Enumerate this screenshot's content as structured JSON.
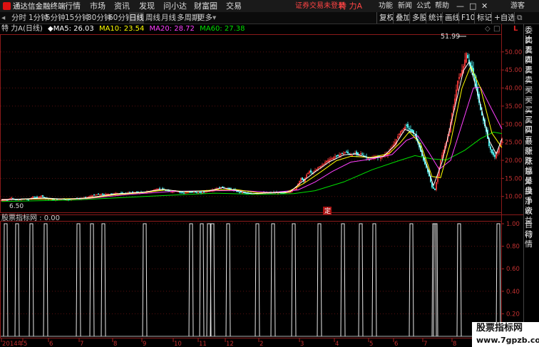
{
  "menubar": {
    "app_title": "通达信金融终端",
    "menus": [
      "行情",
      "市场",
      "资讯",
      "发现",
      "问小达",
      "财富圈",
      "交易"
    ],
    "notice": "证券交易未登录",
    "stock_name": "特 力A",
    "right_items": [
      "功能",
      "新闻",
      "公式",
      "帮助"
    ],
    "user": "游客"
  },
  "toolbar": {
    "periods": [
      "分时",
      "1分钟",
      "5分钟",
      "15分钟",
      "30分钟",
      "60分钟",
      "日线",
      "周线",
      "月线",
      "多周期",
      "更多"
    ],
    "active_period": "日线",
    "tools": [
      "复权",
      "叠加",
      "多股",
      "统计",
      "画线",
      "F10",
      "标记",
      "+自选"
    ]
  },
  "info": {
    "stock": "特 力A",
    "period": "(日线)",
    "ma5_label": "MA5:",
    "ma5": "26.03",
    "ma10_label": "MA10:",
    "ma10": "23.54",
    "ma20_label": "MA20:",
    "ma20": "28.72",
    "ma60_label": "MA60:",
    "ma60": "27.38",
    "colors": {
      "ma5": "#ffffff",
      "ma10": "#ffff00",
      "ma20": "#ff40ff",
      "ma60": "#00e000"
    }
  },
  "price_panel": {
    "high_label": "51.99",
    "low_label": "6.50",
    "marker": "定",
    "yticks": [
      "50.00",
      "45.00",
      "40.00",
      "35.00",
      "30.00",
      "25.00",
      "20.00",
      "15.00",
      "10.00"
    ],
    "ytick_values": [
      50,
      45,
      40,
      35,
      30,
      25,
      20,
      15,
      10
    ],
    "ymin": 6.0,
    "ymax": 54.5
  },
  "indicator_panel": {
    "title": "股票指标网 : 0.00",
    "yticks": [
      "1.00",
      "0.80",
      "0.60",
      "0.40",
      "0.20"
    ]
  },
  "xaxis": {
    "labels": [
      "2014年",
      "5",
      "6",
      "7",
      "8",
      "9",
      "10",
      "11",
      "12",
      "2",
      "3",
      "4",
      "5",
      "6",
      "7",
      "8"
    ]
  },
  "right_panel": {
    "items": [
      "委比",
      "卖五",
      "卖四",
      "卖三",
      "卖二",
      "卖一",
      "买一",
      "买二",
      "买三",
      "买四",
      "买五",
      "最新",
      "涨跌",
      "涨幅",
      "总量",
      "外盘",
      "换手",
      "净资",
      "收益",
      "自动",
      "行情"
    ]
  },
  "chart_data": {
    "type": "candlestick",
    "ylim": [
      6.0,
      54.5
    ],
    "series_names": [
      "MA5",
      "MA10",
      "MA20",
      "MA60"
    ],
    "close_path": [
      [
        0,
        8.9
      ],
      [
        8,
        9.0
      ],
      [
        14,
        9.6
      ],
      [
        20,
        9.0
      ],
      [
        26,
        9.1
      ],
      [
        32,
        9.3
      ],
      [
        38,
        9.1
      ],
      [
        44,
        9.9
      ],
      [
        50,
        9.6
      ],
      [
        56,
        10.2
      ],
      [
        62,
        9.5
      ],
      [
        68,
        9.2
      ],
      [
        74,
        9.0
      ],
      [
        80,
        9.2
      ],
      [
        86,
        9.4
      ],
      [
        92,
        9.0
      ],
      [
        98,
        9.2
      ],
      [
        104,
        9.4
      ],
      [
        110,
        9.3
      ],
      [
        118,
        9.7
      ],
      [
        124,
        10.0
      ],
      [
        130,
        10.4
      ],
      [
        136,
        10.6
      ],
      [
        142,
        10.5
      ],
      [
        148,
        10.7
      ],
      [
        154,
        10.6
      ],
      [
        160,
        10.9
      ],
      [
        166,
        10.8
      ],
      [
        172,
        10.8
      ],
      [
        178,
        11.0
      ],
      [
        184,
        11.1
      ],
      [
        190,
        11.2
      ],
      [
        196,
        11.0
      ],
      [
        202,
        11.2
      ],
      [
        208,
        11.4
      ],
      [
        214,
        11.8
      ],
      [
        220,
        12.1
      ],
      [
        226,
        11.9
      ],
      [
        232,
        11.6
      ],
      [
        238,
        11.3
      ],
      [
        244,
        11.6
      ],
      [
        250,
        11.2
      ],
      [
        256,
        11.0
      ],
      [
        262,
        11.1
      ],
      [
        268,
        11.2
      ],
      [
        274,
        11.1
      ],
      [
        280,
        11.0
      ],
      [
        286,
        11.4
      ],
      [
        292,
        11.6
      ],
      [
        298,
        11.9
      ],
      [
        304,
        12.3
      ],
      [
        310,
        12.6
      ],
      [
        316,
        12.2
      ],
      [
        322,
        12.0
      ],
      [
        328,
        11.6
      ],
      [
        334,
        11.2
      ],
      [
        340,
        11.0
      ],
      [
        346,
        10.8
      ],
      [
        352,
        10.7
      ],
      [
        358,
        10.8
      ],
      [
        364,
        10.9
      ],
      [
        370,
        11.0
      ],
      [
        376,
        11.0
      ],
      [
        382,
        11.1
      ],
      [
        388,
        11.0
      ],
      [
        394,
        10.9
      ],
      [
        400,
        11.2
      ],
      [
        406,
        11.5
      ],
      [
        412,
        12.0
      ],
      [
        416,
        13.5
      ],
      [
        420,
        15.0
      ],
      [
        424,
        14.2
      ],
      [
        428,
        16.0
      ],
      [
        432,
        17.0
      ],
      [
        436,
        16.4
      ],
      [
        440,
        17.2
      ],
      [
        444,
        18.0
      ],
      [
        448,
        18.4
      ],
      [
        452,
        19.0
      ],
      [
        456,
        19.8
      ],
      [
        460,
        20.2
      ],
      [
        464,
        20.6
      ],
      [
        468,
        21.0
      ],
      [
        472,
        21.2
      ],
      [
        476,
        21.8
      ],
      [
        480,
        22.0
      ],
      [
        484,
        22.3
      ],
      [
        488,
        21.7
      ],
      [
        492,
        21.4
      ],
      [
        496,
        22.0
      ],
      [
        500,
        21.6
      ],
      [
        504,
        21.9
      ],
      [
        508,
        21.3
      ],
      [
        512,
        20.8
      ],
      [
        516,
        20.2
      ],
      [
        520,
        20.5
      ],
      [
        524,
        21.0
      ],
      [
        528,
        20.8
      ],
      [
        532,
        20.7
      ],
      [
        536,
        21.3
      ],
      [
        540,
        21.8
      ],
      [
        544,
        22.5
      ],
      [
        548,
        23.6
      ],
      [
        552,
        25.0
      ],
      [
        556,
        26.6
      ],
      [
        560,
        28.0
      ],
      [
        564,
        28.9
      ],
      [
        568,
        29.6
      ],
      [
        572,
        28.6
      ],
      [
        576,
        27.8
      ],
      [
        580,
        27.0
      ],
      [
        584,
        25.0
      ],
      [
        588,
        22.4
      ],
      [
        592,
        20.0
      ],
      [
        596,
        18.0
      ],
      [
        600,
        15.6
      ],
      [
        604,
        12.6
      ],
      [
        608,
        11.8
      ],
      [
        612,
        16.0
      ],
      [
        616,
        20.0
      ],
      [
        620,
        22.8
      ],
      [
        624,
        25.0
      ],
      [
        628,
        28.0
      ],
      [
        632,
        33.0
      ],
      [
        636,
        37.0
      ],
      [
        640,
        42.0
      ],
      [
        644,
        44.0
      ],
      [
        648,
        46.0
      ],
      [
        652,
        49.6
      ],
      [
        656,
        47.0
      ],
      [
        660,
        45.0
      ],
      [
        664,
        42.0
      ],
      [
        668,
        38.0
      ],
      [
        672,
        34.0
      ],
      [
        676,
        31.0
      ],
      [
        680,
        28.0
      ],
      [
        684,
        24.0
      ],
      [
        688,
        22.0
      ],
      [
        692,
        21.0
      ],
      [
        696,
        22.4
      ],
      [
        700,
        24.6
      ],
      [
        702,
        26.0
      ]
    ],
    "ma5": [
      [
        0,
        9.0
      ],
      [
        30,
        9.3
      ],
      [
        60,
        9.6
      ],
      [
        90,
        9.2
      ],
      [
        120,
        9.6
      ],
      [
        160,
        10.7
      ],
      [
        200,
        11.2
      ],
      [
        226,
        12.0
      ],
      [
        250,
        11.4
      ],
      [
        290,
        11.5
      ],
      [
        310,
        12.4
      ],
      [
        330,
        11.7
      ],
      [
        350,
        10.8
      ],
      [
        380,
        11.0
      ],
      [
        405,
        11.3
      ],
      [
        420,
        13.8
      ],
      [
        440,
        16.8
      ],
      [
        460,
        19.6
      ],
      [
        480,
        21.5
      ],
      [
        496,
        21.8
      ],
      [
        516,
        20.6
      ],
      [
        536,
        21.1
      ],
      [
        552,
        24.2
      ],
      [
        566,
        28.6
      ],
      [
        580,
        27.4
      ],
      [
        596,
        19.0
      ],
      [
        606,
        13.0
      ],
      [
        618,
        19.5
      ],
      [
        634,
        33.0
      ],
      [
        648,
        44.8
      ],
      [
        656,
        47.2
      ],
      [
        670,
        37.0
      ],
      [
        684,
        25.5
      ],
      [
        694,
        21.8
      ],
      [
        702,
        26.0
      ]
    ],
    "ma10": [
      [
        0,
        9.1
      ],
      [
        40,
        9.3
      ],
      [
        80,
        9.3
      ],
      [
        120,
        9.5
      ],
      [
        160,
        10.5
      ],
      [
        200,
        11.1
      ],
      [
        230,
        11.8
      ],
      [
        260,
        11.3
      ],
      [
        300,
        11.8
      ],
      [
        330,
        11.9
      ],
      [
        360,
        11.0
      ],
      [
        400,
        11.1
      ],
      [
        424,
        13.6
      ],
      [
        448,
        16.8
      ],
      [
        470,
        19.9
      ],
      [
        490,
        21.1
      ],
      [
        520,
        20.8
      ],
      [
        544,
        21.9
      ],
      [
        560,
        25.0
      ],
      [
        572,
        27.9
      ],
      [
        588,
        24.5
      ],
      [
        604,
        15.5
      ],
      [
        616,
        15.2
      ],
      [
        630,
        25.0
      ],
      [
        646,
        40.0
      ],
      [
        658,
        46.0
      ],
      [
        672,
        40.0
      ],
      [
        688,
        27.5
      ],
      [
        702,
        23.5
      ]
    ],
    "ma20": [
      [
        0,
        9.2
      ],
      [
        60,
        9.3
      ],
      [
        120,
        9.4
      ],
      [
        180,
        10.6
      ],
      [
        240,
        11.4
      ],
      [
        300,
        11.6
      ],
      [
        340,
        11.6
      ],
      [
        380,
        11.1
      ],
      [
        416,
        11.8
      ],
      [
        440,
        14.0
      ],
      [
        464,
        16.9
      ],
      [
        490,
        19.5
      ],
      [
        520,
        20.4
      ],
      [
        548,
        21.6
      ],
      [
        568,
        25.5
      ],
      [
        584,
        26.8
      ],
      [
        600,
        22.0
      ],
      [
        614,
        17.5
      ],
      [
        630,
        20.0
      ],
      [
        646,
        30.0
      ],
      [
        662,
        40.0
      ],
      [
        672,
        40.2
      ],
      [
        688,
        34.0
      ],
      [
        702,
        28.7
      ]
    ],
    "ma60": [
      [
        0,
        8.6
      ],
      [
        100,
        9.0
      ],
      [
        200,
        10.0
      ],
      [
        300,
        10.9
      ],
      [
        360,
        10.6
      ],
      [
        410,
        10.8
      ],
      [
        440,
        11.6
      ],
      [
        480,
        14.0
      ],
      [
        520,
        17.4
      ],
      [
        556,
        19.8
      ],
      [
        580,
        21.3
      ],
      [
        604,
        20.4
      ],
      [
        624,
        20.1
      ],
      [
        650,
        22.8
      ],
      [
        672,
        26.0
      ],
      [
        690,
        27.8
      ],
      [
        702,
        27.4
      ]
    ],
    "indicator_spikes_x": [
      6,
      22,
      42,
      62,
      108,
      127,
      143,
      201,
      266,
      281,
      291,
      296,
      318,
      359,
      381,
      410,
      446,
      479,
      504,
      523,
      575,
      607,
      609,
      642,
      697
    ],
    "indicator_value": 0.0,
    "indicator_ylim": [
      0,
      1.0
    ]
  }
}
